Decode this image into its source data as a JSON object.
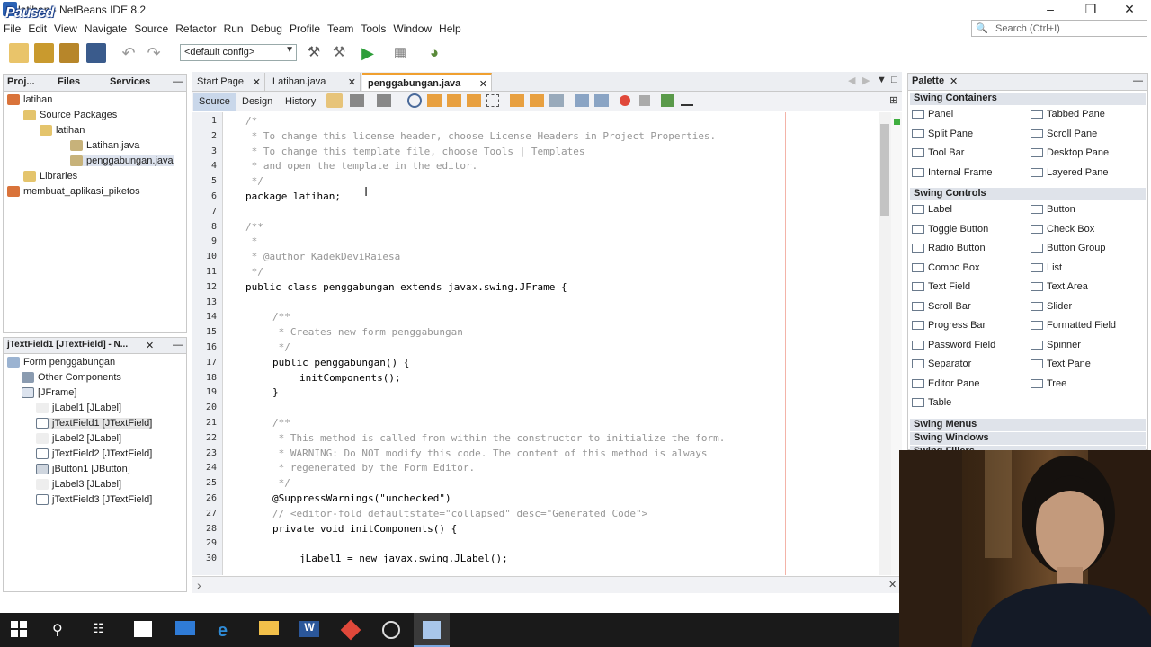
{
  "window": {
    "title": "NetBeans IDE 8.2",
    "title_prefix": "latihan -",
    "overlay": "Paused"
  },
  "menu": [
    "File",
    "Edit",
    "View",
    "Navigate",
    "Source",
    "Refactor",
    "Run",
    "Debug",
    "Profile",
    "Team",
    "Tools",
    "Window",
    "Help"
  ],
  "search": {
    "placeholder": "Search (Ctrl+I)"
  },
  "toolbar": {
    "config_value": "<default config>"
  },
  "projects_panel": {
    "tabs": [
      "Proj...",
      "Files",
      "Services"
    ],
    "tree": [
      {
        "label": "latihan",
        "level": 0
      },
      {
        "label": "Source Packages",
        "level": 1
      },
      {
        "label": "latihan",
        "level": 2
      },
      {
        "label": "Latihan.java",
        "level": 3
      },
      {
        "label": "penggabungan.java",
        "level": 3
      },
      {
        "label": "Libraries",
        "level": 1
      },
      {
        "label": "membuat_aplikasi_piketos",
        "level": 0
      }
    ]
  },
  "navigator_panel": {
    "title": "jTextField1 [JTextField] - N...",
    "tree": [
      {
        "label": "Form penggabungan",
        "level": 0
      },
      {
        "label": "Other Components",
        "level": 1
      },
      {
        "label": "[JFrame]",
        "level": 1
      },
      {
        "label": "jLabel1 [JLabel]",
        "level": 2
      },
      {
        "label": "jTextField1 [JTextField]",
        "level": 2
      },
      {
        "label": "jLabel2 [JLabel]",
        "level": 2
      },
      {
        "label": "jTextField2 [JTextField]",
        "level": 2
      },
      {
        "label": "jButton1 [JButton]",
        "level": 2
      },
      {
        "label": "jLabel3 [JLabel]",
        "level": 2
      },
      {
        "label": "jTextField3 [JTextField]",
        "level": 2
      }
    ]
  },
  "editor": {
    "tabs": [
      "Start Page",
      "Latihan.java",
      "penggabungan.java"
    ],
    "view_tabs": [
      "Source",
      "Design",
      "History"
    ],
    "lines": [
      {
        "n": "1",
        "indent": 0,
        "cls": "cmt",
        "text": "/*"
      },
      {
        "n": "2",
        "indent": 0,
        "cls": "cmt",
        "text": " * To change this license header, choose License Headers in Project Properties."
      },
      {
        "n": "3",
        "indent": 0,
        "cls": "cmt",
        "text": " * To change this template file, choose Tools | Templates"
      },
      {
        "n": "4",
        "indent": 0,
        "cls": "cmt",
        "text": " * and open the template in the editor."
      },
      {
        "n": "5",
        "indent": 0,
        "cls": "cmt",
        "text": " */"
      },
      {
        "n": "6",
        "indent": 0,
        "cls": "",
        "text": "package latihan;"
      },
      {
        "n": "7",
        "indent": 0,
        "cls": "",
        "text": ""
      },
      {
        "n": "8",
        "indent": 0,
        "cls": "cmt",
        "text": "/**"
      },
      {
        "n": "9",
        "indent": 0,
        "cls": "cmt",
        "text": " *"
      },
      {
        "n": "10",
        "indent": 0,
        "cls": "cmt",
        "text": " * @author KadekDeviRaiesa"
      },
      {
        "n": "11",
        "indent": 0,
        "cls": "cmt",
        "text": " */"
      },
      {
        "n": "12",
        "indent": 0,
        "cls": "",
        "text": "public class penggabungan extends javax.swing.JFrame {"
      },
      {
        "n": "13",
        "indent": 0,
        "cls": "",
        "text": ""
      },
      {
        "n": "14",
        "indent": 1,
        "cls": "cmt",
        "text": "/**"
      },
      {
        "n": "15",
        "indent": 1,
        "cls": "cmt",
        "text": " * Creates new form penggabungan"
      },
      {
        "n": "16",
        "indent": 1,
        "cls": "cmt",
        "text": " */"
      },
      {
        "n": "17",
        "indent": 1,
        "cls": "",
        "text": "public penggabungan() {"
      },
      {
        "n": "18",
        "indent": 2,
        "cls": "",
        "text": "initComponents();"
      },
      {
        "n": "19",
        "indent": 1,
        "cls": "",
        "text": "}"
      },
      {
        "n": "20",
        "indent": 0,
        "cls": "",
        "text": ""
      },
      {
        "n": "21",
        "indent": 1,
        "cls": "cmt",
        "text": "/**"
      },
      {
        "n": "22",
        "indent": 1,
        "cls": "cmt",
        "text": " * This method is called from within the constructor to initialize the form."
      },
      {
        "n": "23",
        "indent": 1,
        "cls": "cmt",
        "text": " * WARNING: Do NOT modify this code. The content of this method is always"
      },
      {
        "n": "24",
        "indent": 1,
        "cls": "cmt",
        "text": " * regenerated by the Form Editor."
      },
      {
        "n": "25",
        "indent": 1,
        "cls": "cmt",
        "text": " */"
      },
      {
        "n": "26",
        "indent": 1,
        "cls": "",
        "text": "@SuppressWarnings(\"unchecked\")"
      },
      {
        "n": "27",
        "indent": 1,
        "cls": "cmt",
        "text": "// <editor-fold defaultstate=\"collapsed\" desc=\"Generated Code\">"
      },
      {
        "n": "28",
        "indent": 1,
        "cls": "",
        "text": "private void initComponents() {"
      },
      {
        "n": "29",
        "indent": 0,
        "cls": "",
        "text": ""
      },
      {
        "n": "30",
        "indent": 2,
        "cls": "",
        "text": "jLabel1 = new javax.swing.JLabel();"
      }
    ]
  },
  "palette": {
    "title": "Palette",
    "categories": [
      {
        "name": "Swing Containers",
        "items": [
          "Panel",
          "Tabbed Pane",
          "Split Pane",
          "Scroll Pane",
          "Tool Bar",
          "Desktop Pane",
          "Internal Frame",
          "Layered Pane"
        ]
      },
      {
        "name": "Swing Controls",
        "items": [
          "Label",
          "Button",
          "Toggle Button",
          "Check Box",
          "Radio Button",
          "Button Group",
          "Combo Box",
          "List",
          "Text Field",
          "Text Area",
          "Scroll Bar",
          "Slider",
          "Progress Bar",
          "Formatted Field",
          "Password Field",
          "Spinner",
          "Separator",
          "Text Pane",
          "Editor Pane",
          "Tree",
          "Table"
        ]
      },
      {
        "name": "Swing Menus",
        "items": []
      },
      {
        "name": "Swing Windows",
        "items": []
      },
      {
        "name": "Swing Fillers",
        "items": []
      }
    ]
  },
  "colors": {
    "accent": "#2b63b5",
    "keyword": "#0000e6",
    "comment": "#969696",
    "string": "#ce7b00",
    "taskbar": "#1a1a1a"
  },
  "icons": [
    "windows-start-icon",
    "search-icon",
    "task-view-icon",
    "store-icon",
    "mail-icon",
    "edge-icon",
    "explorer-icon",
    "word-icon",
    "git-icon",
    "obs-icon",
    "netbeans-icon"
  ]
}
